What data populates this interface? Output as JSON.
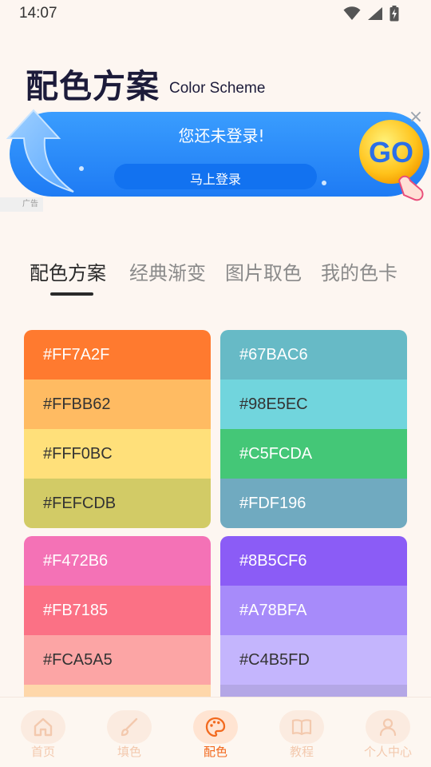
{
  "status_bar": {
    "time": "14:07",
    "icons": [
      "wifi-icon",
      "signal-icon",
      "battery-charging-icon"
    ]
  },
  "header": {
    "title": "配色方案",
    "subtitle": "Color Scheme"
  },
  "ad": {
    "message": "您还未登录!",
    "button_label": "马上登录",
    "badge_text": "GO",
    "tag_label": "广告",
    "close_icon": "close-icon"
  },
  "tabs": [
    {
      "label": "配色方案",
      "active": true
    },
    {
      "label": "经典渐变",
      "active": false
    },
    {
      "label": "图片取色",
      "active": false
    },
    {
      "label": "我的色卡",
      "active": false
    }
  ],
  "palettes": [
    {
      "swatches": [
        {
          "hex": "#FF7A2F",
          "label": "#FF7A2F",
          "text_color": "#FFFFFF"
        },
        {
          "hex": "#FFBB62",
          "label": "#FFBB62",
          "text_color": "#333333"
        },
        {
          "hex": "#FFE07A",
          "label": "#FFF0BC",
          "text_color": "#333333"
        },
        {
          "hex": "#D2CB66",
          "label": "#FEFCDB",
          "text_color": "#333333"
        }
      ]
    },
    {
      "swatches": [
        {
          "hex": "#67BAC6",
          "label": "#67BAC6",
          "text_color": "#FFFFFF"
        },
        {
          "hex": "#71D5DD",
          "label": "#98E5EC",
          "text_color": "#333333"
        },
        {
          "hex": "#44C777",
          "label": "#C5FCDA",
          "text_color": "#FFFFFF"
        },
        {
          "hex": "#70AAC0",
          "label": "#FDF196",
          "text_color": "#FFFFFF"
        }
      ]
    },
    {
      "swatches": [
        {
          "hex": "#F472B6",
          "label": "#F472B6",
          "text_color": "#FFFFFF"
        },
        {
          "hex": "#FB7185",
          "label": "#FB7185",
          "text_color": "#FFFFFF"
        },
        {
          "hex": "#FCA5A5",
          "label": "#FCA5A5",
          "text_color": "#333333"
        },
        {
          "hex": "#FED7AA",
          "label": "",
          "text_color": "#333333"
        }
      ]
    },
    {
      "swatches": [
        {
          "hex": "#8B5CF6",
          "label": "#8B5CF6",
          "text_color": "#FFFFFF"
        },
        {
          "hex": "#A78BFA",
          "label": "#A78BFA",
          "text_color": "#FFFFFF"
        },
        {
          "hex": "#C4B5FD",
          "label": "#C4B5FD",
          "text_color": "#333333"
        },
        {
          "hex": "#B4A7E6",
          "label": "",
          "text_color": "#333333"
        }
      ]
    }
  ],
  "bottom_nav": [
    {
      "label": "首页",
      "icon": "home-icon",
      "active": false
    },
    {
      "label": "填色",
      "icon": "brush-icon",
      "active": false
    },
    {
      "label": "配色",
      "icon": "palette-icon",
      "active": true
    },
    {
      "label": "教程",
      "icon": "book-icon",
      "active": false
    },
    {
      "label": "个人中心",
      "icon": "user-icon",
      "active": false
    }
  ],
  "colors": {
    "background": "#FDF6F1",
    "accent": "#F26A1F",
    "ad_blue": "#2B8CFA",
    "title": "#1C1B3A"
  }
}
